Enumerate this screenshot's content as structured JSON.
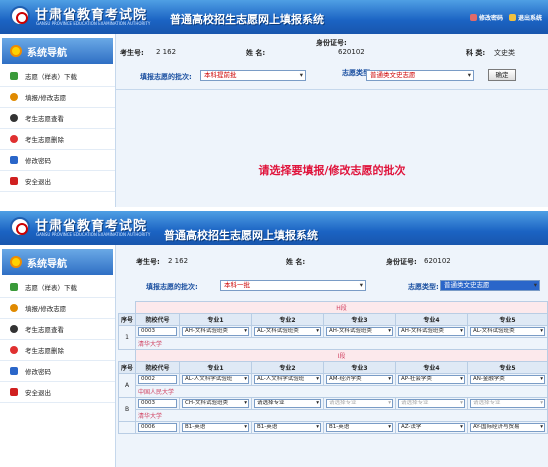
{
  "banner": {
    "logo_text": "甘肃省教育考试院",
    "logo_sub": "GANSU PROVINCE EDUCATION EXAMINATION AUTHORITY",
    "title": "普通高校招生志愿网上填报系统",
    "links": [
      "修改密码",
      "退出系统"
    ]
  },
  "sidebar": {
    "title": "系统导航",
    "items": [
      {
        "label": "志愿（样表）下载",
        "color": "#3a9a3a"
      },
      {
        "label": "填报/修改志愿",
        "color": "#e08a00"
      },
      {
        "label": "考生志愿查看",
        "color": "#333"
      },
      {
        "label": "考生志愿删除",
        "color": "#e03030"
      },
      {
        "label": "修改密码",
        "color": "#2a66c9"
      },
      {
        "label": "安全退出",
        "color": "#d02020"
      }
    ]
  },
  "screen1": {
    "exam_label": "考生号:",
    "exam_value": "2 162",
    "name_label": "姓 名:",
    "id_label": "身份证号:",
    "id_value": "620102",
    "subject_label": "科 类:",
    "subject_value": "文史类",
    "batch_label": "填报志愿的批次:",
    "batch_value": "本科提前批",
    "type_label": "志愿类型:",
    "type_value": "普通类文史志愿",
    "confirm_button": "确定",
    "message": "请选择要填报/修改志愿的批次"
  },
  "screen2": {
    "exam_label": "考生号:",
    "exam_value": "2 162",
    "name_label": "姓 名:",
    "id_label": "身份证号:",
    "id_value": "620102",
    "batch_label": "填报志愿的批次:",
    "batch_value": "本科一批",
    "type_label": "志愿类型:",
    "type_value": "普通类文史志愿",
    "table_headers": [
      "序号",
      "院校代号",
      "专业1",
      "专业2",
      "专业3",
      "专业4",
      "专业5"
    ],
    "sections": [
      {
        "title": "H段",
        "rows": [
          {
            "seq": "1",
            "code": "0003",
            "majors": [
              "AH-文科试验班类",
              "AL-文科试验班类",
              "AH-文科试验班类",
              "AH-文科试验班类",
              "AL-文科试验班类"
            ],
            "college": "清华大学"
          }
        ]
      },
      {
        "title": "I段",
        "rows": [
          {
            "seq": "A",
            "code": "0002",
            "majors": [
              "AL-人文科学试验班",
              "AL-人文科学试验班",
              "AM-经济学类",
              "AP-社会学类",
              "AN-金融学类"
            ],
            "college": "中国人民大学"
          },
          {
            "seq": "B",
            "code": "0003",
            "majors": [
              "CH-文科试验班类",
              "请选择专业",
              "请选择专业",
              "请选择专业",
              "请选择专业"
            ],
            "college": "清华大学"
          },
          {
            "seq": "",
            "code": "0006",
            "majors": [
              "B1-英语",
              "B1-英语",
              "B1-英语",
              "AZ-法学",
              "AY-国际经济与贸易"
            ],
            "college": ""
          }
        ]
      }
    ]
  }
}
